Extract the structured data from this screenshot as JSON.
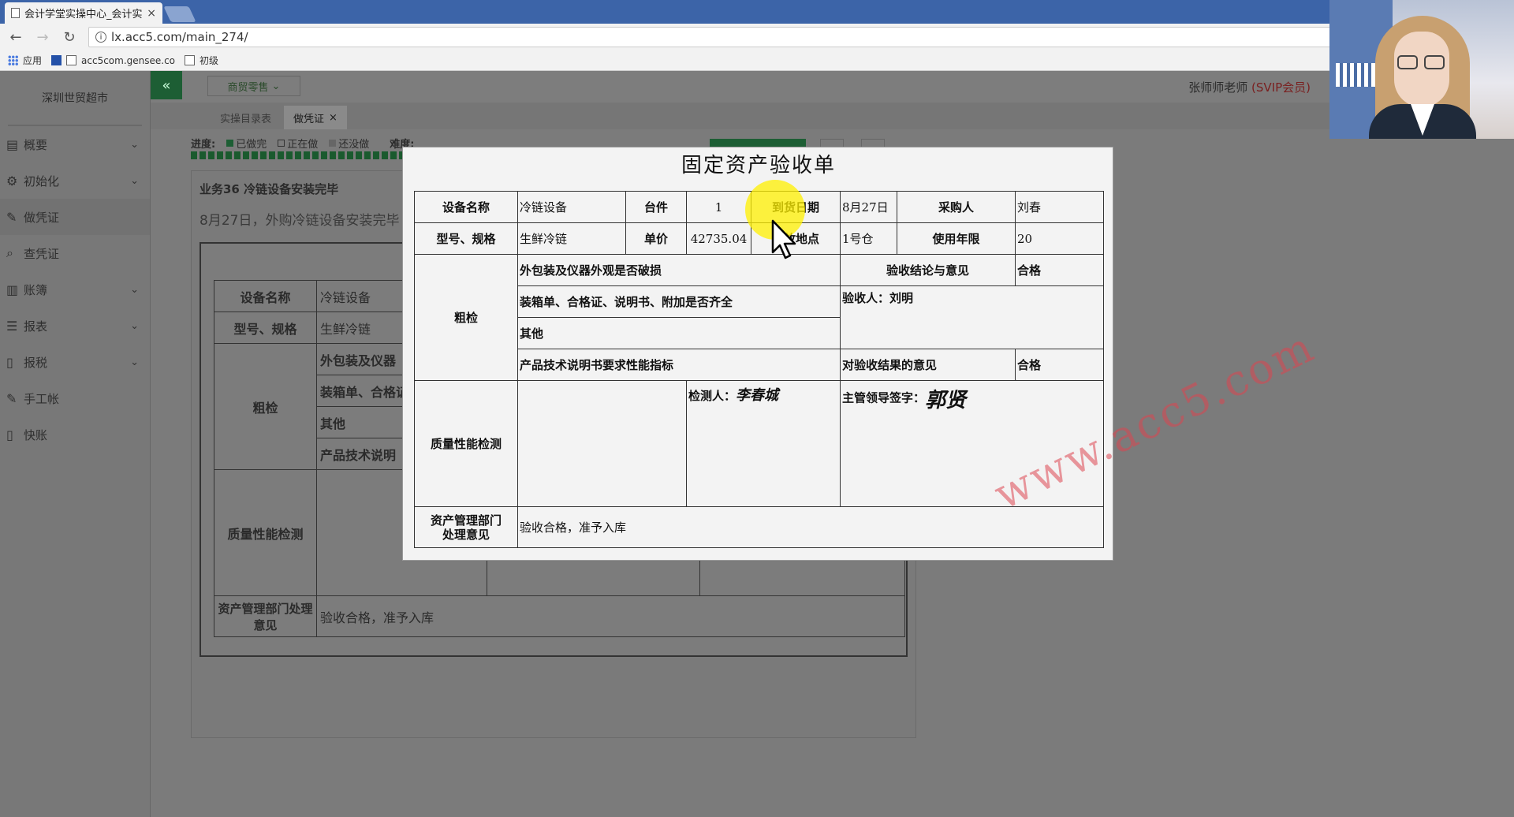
{
  "browser": {
    "tab_title": "会计学堂实操中心_会计实",
    "tab_close": "×",
    "url": "lx.acc5.com/main_274/",
    "bookmarks": [
      "应用",
      "acc5com.gensee.co",
      "初级"
    ]
  },
  "sidebar": {
    "company": "深圳世贸超市",
    "items": [
      {
        "label": "概要",
        "icon": "overview-icon",
        "has_arrow": true
      },
      {
        "label": "初始化",
        "icon": "gear-icon",
        "has_arrow": true
      },
      {
        "label": "做凭证",
        "icon": "pen-icon",
        "has_arrow": false,
        "active": true
      },
      {
        "label": "查凭证",
        "icon": "search-icon",
        "has_arrow": false
      },
      {
        "label": "账簿",
        "icon": "book-icon",
        "has_arrow": true
      },
      {
        "label": "报表",
        "icon": "report-icon",
        "has_arrow": true
      },
      {
        "label": "报税",
        "icon": "file-icon",
        "has_arrow": true
      },
      {
        "label": "手工帐",
        "icon": "pen-icon",
        "has_arrow": false
      },
      {
        "label": "快账",
        "icon": "file-icon",
        "has_arrow": false
      }
    ]
  },
  "header": {
    "collapse_symbol": "«",
    "industry": "商贸零售",
    "teacher_name": "张师师老师",
    "member_level": "(SVIP会员)"
  },
  "subtabs": [
    {
      "label": "实操目录表",
      "active": false
    },
    {
      "label": "做凭证",
      "active": true,
      "closable": true
    }
  ],
  "progress": {
    "label": "进度:",
    "legend_done": "已做完",
    "legend_doing": "正在做",
    "legend_todo": "还没做",
    "difficulty_label": "难度:"
  },
  "task": {
    "title": "业务36 冷链设备安装完毕",
    "description": "8月27日，外购冷链设备安装完毕"
  },
  "background_form": {
    "rows": [
      "设备名称",
      "型号、规格",
      "粗检",
      "质量性能检测",
      "资产管理部门处理意见"
    ],
    "equipment_name": "冷链设备",
    "model": "生鲜冷链",
    "rough_items": [
      "外包装及仪器",
      "装箱单、合格证",
      "其他",
      "产品技术说明"
    ],
    "dept_opinion": "验收合格，准予入库"
  },
  "modal": {
    "title": "固定资产验收单",
    "labels": {
      "equipment_name": "设备名称",
      "quantity": "台件",
      "arrival_date": "到货日期",
      "purchaser": "采购人",
      "model": "型号、规格",
      "unit_price": "单价",
      "location": "存放地点",
      "service_life": "使用年限",
      "rough_check": "粗检",
      "conclusion": "验收结论与意见",
      "acceptor": "验收人：刘明",
      "result_opinion": "对验收结果的意见",
      "quality_test": "质量性能检测",
      "inspector": "检测人：",
      "leader_sign": "主管领导签字：",
      "dept_opinion_1": "资产管理部门",
      "dept_opinion_2": "处理意见"
    },
    "values": {
      "equipment_name": "冷链设备",
      "quantity": "1",
      "arrival_date": "8月27日",
      "purchaser": "刘春",
      "model": "生鲜冷链",
      "unit_price": "42735.04",
      "location": "1号仓",
      "service_life": "20",
      "conclusion": "合格",
      "result_opinion": "合格",
      "inspector_sign": "李春城",
      "leader_sign_name": "郭贤",
      "dept_opinion": "验收合格，准予入库"
    },
    "rough_items": [
      "外包装及仪器外观是否破损",
      "装箱单、合格证、说明书、附加是否齐全",
      "其他",
      "产品技术说明书要求性能指标"
    ],
    "watermark": "www.acc5.com"
  },
  "colors": {
    "accent_green": "#1d5e34",
    "svip_red": "#7a2020",
    "watermark": "#dc4650",
    "highlight": "#fff000"
  }
}
